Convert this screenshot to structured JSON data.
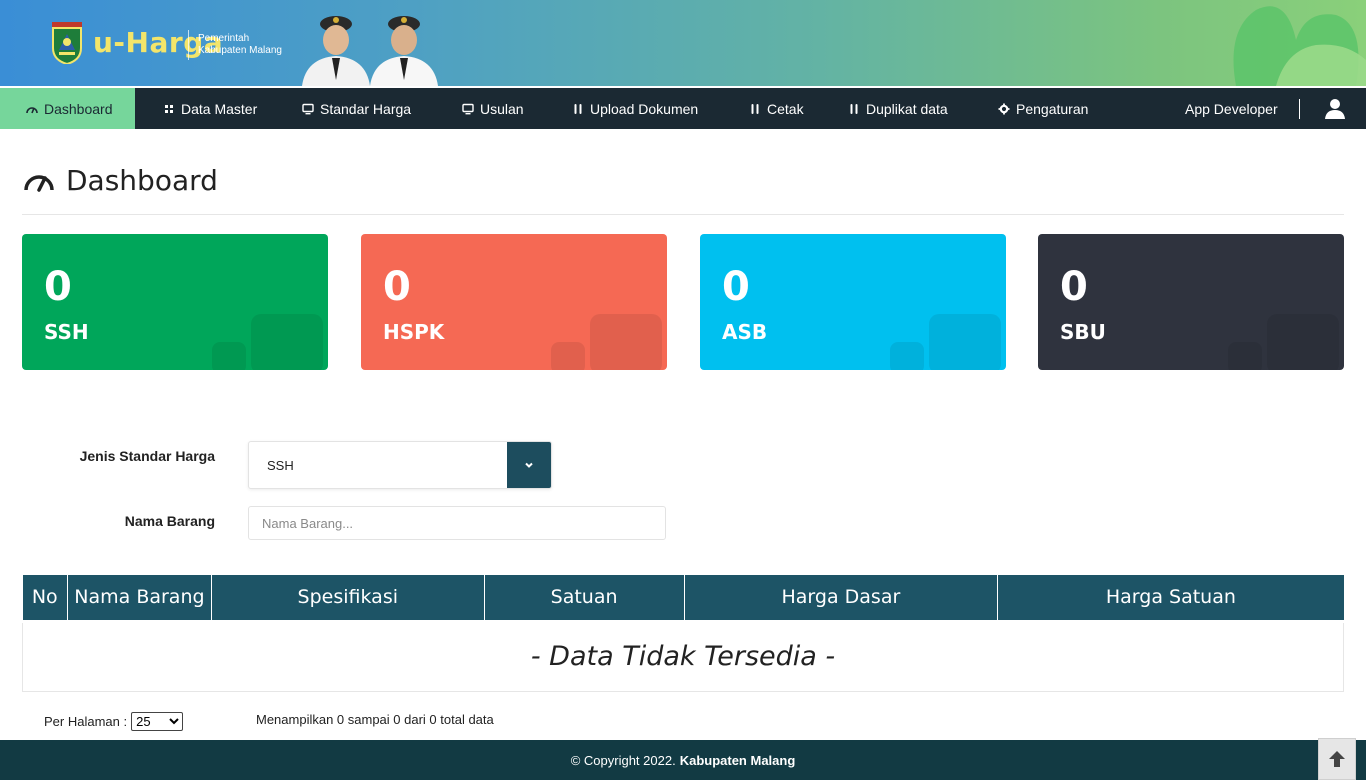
{
  "header": {
    "brand": "u-Harga",
    "org_line1": "Pemerintah",
    "org_line2": "Kabupaten Malang",
    "emblem_icon": "kabupaten-malang-emblem",
    "officials_image": "regional-officials-photo"
  },
  "nav": {
    "items": [
      {
        "label": "Dashboard",
        "icon": "gauge-icon",
        "active": true
      },
      {
        "label": "Data Master",
        "icon": "grid-icon"
      },
      {
        "label": "Standar Harga",
        "icon": "monitor-icon"
      },
      {
        "label": "Usulan",
        "icon": "monitor-icon"
      },
      {
        "label": "Upload Dokumen",
        "icon": "tools-icon"
      },
      {
        "label": "Cetak",
        "icon": "tools-icon"
      },
      {
        "label": "Duplikat data",
        "icon": "tools-icon"
      },
      {
        "label": "Pengaturan",
        "icon": "gear-icon"
      }
    ],
    "user_name": "App Developer"
  },
  "page": {
    "title": "Dashboard"
  },
  "cards": [
    {
      "count": "0",
      "label": "SSH",
      "color": "#00a65a"
    },
    {
      "count": "0",
      "label": "HSPK",
      "color": "#f56954"
    },
    {
      "count": "0",
      "label": "ASB",
      "color": "#00c0ef"
    },
    {
      "count": "0",
      "label": "SBU",
      "color": "#2f333e"
    }
  ],
  "form": {
    "jenis_label": "Jenis Standar Harga",
    "jenis_value": "SSH",
    "nama_label": "Nama Barang",
    "nama_placeholder": "Nama Barang..."
  },
  "table": {
    "headers": [
      "No",
      "Nama Barang",
      "Spesifikasi",
      "Satuan",
      "Harga Dasar",
      "Harga Satuan"
    ],
    "empty_message": "- Data Tidak Tersedia -"
  },
  "pagination": {
    "per_page_label": "Per Halaman :",
    "per_page_value": "25",
    "summary": "Menampilkan 0 sampai 0 dari 0 total data"
  },
  "footer": {
    "copyright": "© Copyright 2022.",
    "org": "Kabupaten Malang"
  },
  "colors": {
    "navbar": "#1b2933",
    "nav_active": "#76d69b",
    "table_header": "#1d5466",
    "footer": "#123a43"
  }
}
